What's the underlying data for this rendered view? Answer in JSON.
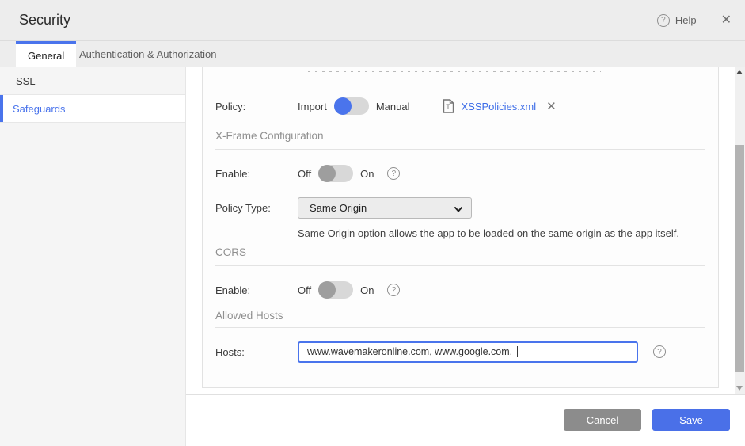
{
  "header": {
    "title": "Security",
    "help_label": "Help"
  },
  "tabs": [
    {
      "label": "General",
      "active": true
    },
    {
      "label": "Authentication & Authorization",
      "active": false
    }
  ],
  "sidebar": {
    "items": [
      {
        "label": "SSL",
        "selected": false
      },
      {
        "label": "Safeguards",
        "selected": true
      }
    ]
  },
  "form": {
    "policy": {
      "label": "Policy:",
      "option_left": "Import",
      "option_right": "Manual",
      "selected": "Import",
      "file_name": "XSSPolicies.xml"
    },
    "xframe": {
      "section_title": "X-Frame Configuration",
      "enable_label": "Enable:",
      "toggle_off": "Off",
      "toggle_on": "On",
      "state": "Off",
      "policy_type_label": "Policy Type:",
      "policy_type_value": "Same Origin",
      "description": "Same Origin option allows the app to be loaded on the same origin as the app itself."
    },
    "cors": {
      "section_title": "CORS",
      "enable_label": "Enable:",
      "toggle_off": "Off",
      "toggle_on": "On",
      "state": "Off"
    },
    "allowed_hosts": {
      "section_title": "Allowed Hosts",
      "hosts_label": "Hosts:",
      "hosts_value": "www.wavemakeronline.com, www.google.com, "
    }
  },
  "footer": {
    "cancel_label": "Cancel",
    "save_label": "Save"
  },
  "colors": {
    "accent_blue": "#4a74ec",
    "link_blue": "#3d6de8",
    "save_blue": "#4a70e8",
    "cancel_gray": "#8c8c8c",
    "knob_gray": "#9e9e9e",
    "toggle_track": "#d8d8d8"
  }
}
